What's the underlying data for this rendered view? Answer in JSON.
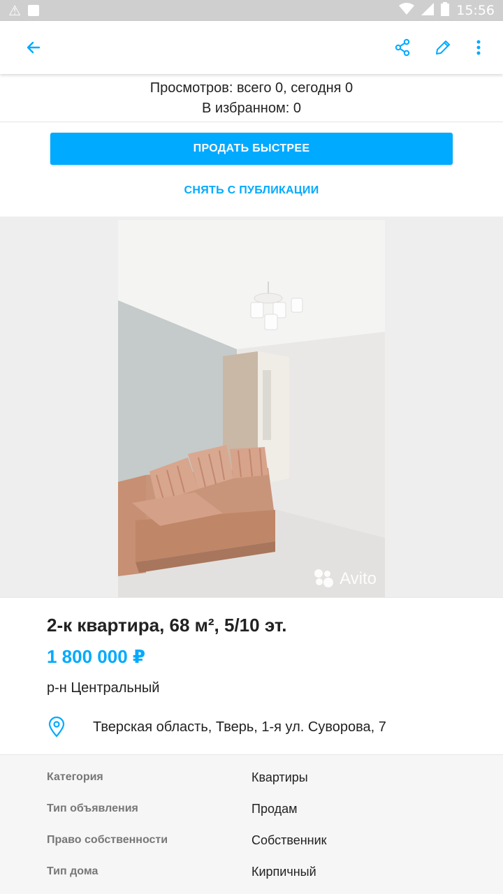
{
  "status_bar": {
    "time": "15:56",
    "icons": [
      "warning-icon",
      "notification-icon",
      "wifi-icon",
      "signal-icon",
      "battery-icon"
    ]
  },
  "app_bar": {
    "icons": [
      "back-arrow-icon",
      "share-icon",
      "pencil-icon",
      "more-vert-icon"
    ],
    "accent_color": "#00aaff"
  },
  "stats": {
    "views": "Просмотров: всего 0, сегодня 0",
    "favorites": "В избранном: 0"
  },
  "actions": {
    "sell_faster": "ПРОДАТЬ БЫСТРЕЕ",
    "unpublish": "СНЯТЬ С ПУБЛИКАЦИИ"
  },
  "photo": {
    "watermark": "Avito"
  },
  "listing": {
    "title": "2-к квартира, 68 м², 5/10 эт.",
    "price": "1 800 000 ₽",
    "district": "р-н Центральный",
    "address": "Тверская область, Тверь, 1-я ул. Суворова, 7"
  },
  "params": [
    {
      "label": "Категория",
      "value": "Квартиры"
    },
    {
      "label": "Тип объявления",
      "value": "Продам"
    },
    {
      "label": "Право собственности",
      "value": "Собственник"
    },
    {
      "label": "Тип дома",
      "value": "Кирпичный"
    }
  ]
}
